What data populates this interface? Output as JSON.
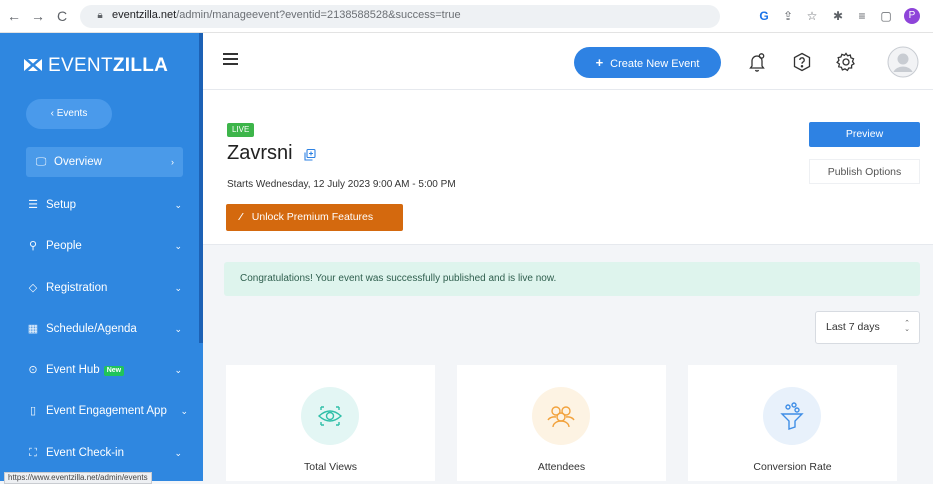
{
  "browser": {
    "url_host": "eventzilla.net",
    "url_path": "/admin/manageevent?eventid=2138588528&success=true",
    "profile_initial": "P",
    "status_url": "https://www.eventzilla.net/admin/events"
  },
  "brand": {
    "name_light": "EVENT",
    "name_bold": "ZILLA"
  },
  "sidebar": {
    "back_label": "‹ Events",
    "items": [
      {
        "label": "Overview",
        "icon": "monitor-icon"
      },
      {
        "label": "Setup",
        "icon": "sliders-icon"
      },
      {
        "label": "People",
        "icon": "person-icon"
      },
      {
        "label": "Registration",
        "icon": "tag-icon"
      },
      {
        "label": "Schedule/Agenda",
        "icon": "calendar-icon"
      },
      {
        "label": "Event Hub",
        "icon": "play-circle-icon",
        "badge": "New"
      },
      {
        "label": "Event Engagement App",
        "icon": "phone-icon"
      },
      {
        "label": "Event Check-in",
        "icon": "scan-icon"
      }
    ]
  },
  "header": {
    "create_label": "Create New Event"
  },
  "event": {
    "status": "LIVE",
    "title": "Zavrsni",
    "date_text": "Starts Wednesday, 12 July 2023 9:00 AM - 5:00 PM",
    "unlock_label": "Unlock Premium Features",
    "preview_label": "Preview",
    "publish_label": "Publish Options"
  },
  "alert": {
    "message": "Congratulations! Your event was successfully published and is live now."
  },
  "range": {
    "selected": "Last 7 days"
  },
  "stats": [
    {
      "label": "Total Views",
      "icon": "eye-icon",
      "color": "#e3f6f4"
    },
    {
      "label": "Attendees",
      "icon": "group-icon",
      "color": "#fdf3e3"
    },
    {
      "label": "Conversion Rate",
      "icon": "funnel-icon",
      "color": "#e8f1fb"
    }
  ],
  "colors": {
    "sidebar": "#2f87e0",
    "primary": "#2e82e3",
    "live": "#3db54a",
    "unlock": "#d4690e",
    "alert_bg": "#def4ed"
  }
}
